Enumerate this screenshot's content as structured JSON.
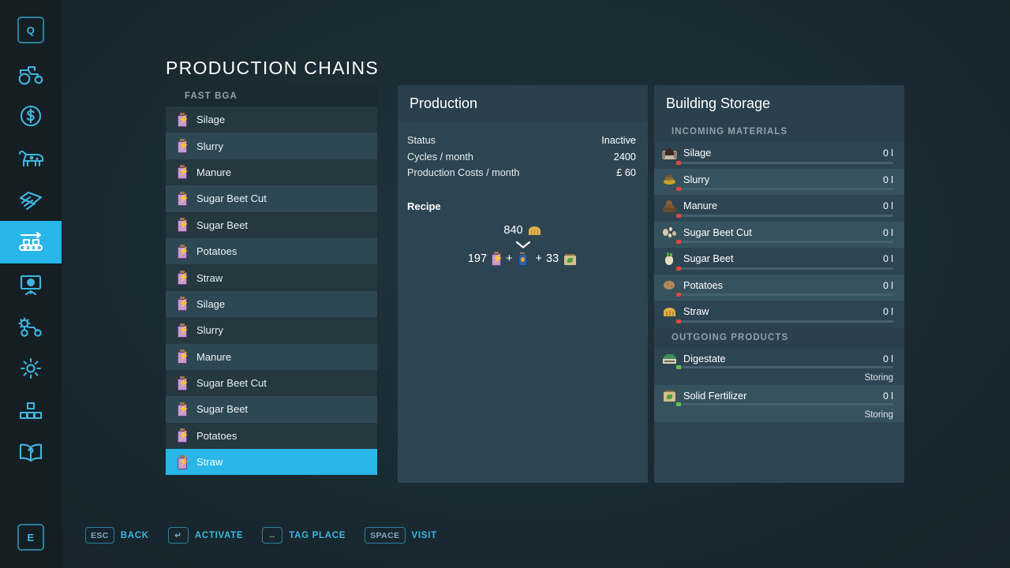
{
  "page": {
    "title": "PRODUCTION CHAINS",
    "accent_color": "#29b6e8",
    "panel_color": "#2d4552",
    "background_color": "#1a2a31"
  },
  "sidebar": {
    "top_key": "Q",
    "bottom_key": "E",
    "items": [
      {
        "name": "vehicles",
        "icon": "tractor-icon",
        "active": false
      },
      {
        "name": "finances",
        "icon": "money-icon",
        "active": false
      },
      {
        "name": "animals",
        "icon": "cow-icon",
        "active": false
      },
      {
        "name": "contracts",
        "icon": "documents-icon",
        "active": false
      },
      {
        "name": "production",
        "icon": "production-chain-icon",
        "active": true
      },
      {
        "name": "statistics",
        "icon": "monitor-icon",
        "active": false
      },
      {
        "name": "vehicle-settings",
        "icon": "gear-tractor-icon",
        "active": false
      },
      {
        "name": "settings",
        "icon": "gear-icon",
        "active": false
      },
      {
        "name": "construction",
        "icon": "blocks-icon",
        "active": false
      },
      {
        "name": "help",
        "icon": "help-book-icon",
        "active": false
      }
    ]
  },
  "chain_list": {
    "header": "FAST BGA",
    "selected_index": 13,
    "items": [
      {
        "label": "Silage",
        "icon": "battery-icon"
      },
      {
        "label": "Slurry",
        "icon": "battery-icon"
      },
      {
        "label": "Manure",
        "icon": "battery-icon"
      },
      {
        "label": "Sugar Beet Cut",
        "icon": "battery-icon"
      },
      {
        "label": "Sugar Beet",
        "icon": "battery-icon"
      },
      {
        "label": "Potatoes",
        "icon": "battery-icon"
      },
      {
        "label": "Straw",
        "icon": "battery-icon"
      },
      {
        "label": "Silage",
        "icon": "battery-icon"
      },
      {
        "label": "Slurry",
        "icon": "battery-icon"
      },
      {
        "label": "Manure",
        "icon": "battery-icon"
      },
      {
        "label": "Sugar Beet Cut",
        "icon": "battery-icon"
      },
      {
        "label": "Sugar Beet",
        "icon": "battery-icon"
      },
      {
        "label": "Potatoes",
        "icon": "battery-icon"
      },
      {
        "label": "Straw",
        "icon": "battery-icon"
      }
    ]
  },
  "production": {
    "title": "Production",
    "stats": [
      {
        "label": "Status",
        "value": "Inactive"
      },
      {
        "label": "Cycles / month",
        "value": "2400"
      },
      {
        "label": "Production Costs / month",
        "value": "£ 60"
      }
    ],
    "recipe_label": "Recipe",
    "recipe": {
      "inputs": [
        {
          "amount": "840",
          "icon": "straw-icon"
        }
      ],
      "outputs": [
        {
          "amount": "197",
          "icon": "battery-icon",
          "separator": "+"
        },
        {
          "amount": "",
          "icon": "digestate-bottle-icon",
          "separator": "+"
        },
        {
          "amount": "33",
          "icon": "fertilizer-bag-icon",
          "separator": ""
        }
      ]
    }
  },
  "storage": {
    "title": "Building Storage",
    "incoming_header": "INCOMING MATERIALS",
    "incoming": [
      {
        "name": "Silage",
        "value": "0 l",
        "icon": "silage-icon",
        "fill": 0,
        "status_color": "#e2453c"
      },
      {
        "name": "Slurry",
        "value": "0 l",
        "icon": "slurry-icon",
        "fill": 0,
        "status_color": "#e2453c"
      },
      {
        "name": "Manure",
        "value": "0 l",
        "icon": "manure-icon",
        "fill": 0,
        "status_color": "#e2453c"
      },
      {
        "name": "Sugar Beet Cut",
        "value": "0 l",
        "icon": "sugar-beet-cut-icon",
        "fill": 0,
        "status_color": "#e2453c"
      },
      {
        "name": "Sugar Beet",
        "value": "0 l",
        "icon": "sugar-beet-icon",
        "fill": 0,
        "status_color": "#e2453c"
      },
      {
        "name": "Potatoes",
        "value": "0 l",
        "icon": "potato-icon",
        "fill": 0,
        "status_color": "#e2453c"
      },
      {
        "name": "Straw",
        "value": "0 l",
        "icon": "straw-icon",
        "fill": 0,
        "status_color": "#e2453c"
      }
    ],
    "outgoing_header": "OUTGOING PRODUCTS",
    "outgoing": [
      {
        "name": "Digestate",
        "value": "0 l",
        "icon": "digestate-icon",
        "state": "Storing",
        "fill": 0,
        "status_color": "#5fc447"
      },
      {
        "name": "Solid Fertilizer",
        "value": "0 l",
        "icon": "fertilizer-bag-icon",
        "state": "Storing",
        "fill": 0,
        "status_color": "#5fc447"
      }
    ]
  },
  "hints": [
    {
      "key": "ESC",
      "label": "BACK"
    },
    {
      "key": "↵",
      "label": "ACTIVATE"
    },
    {
      "key": "↔",
      "label": "TAG PLACE"
    },
    {
      "key": "SPACE",
      "label": "VISIT"
    }
  ]
}
